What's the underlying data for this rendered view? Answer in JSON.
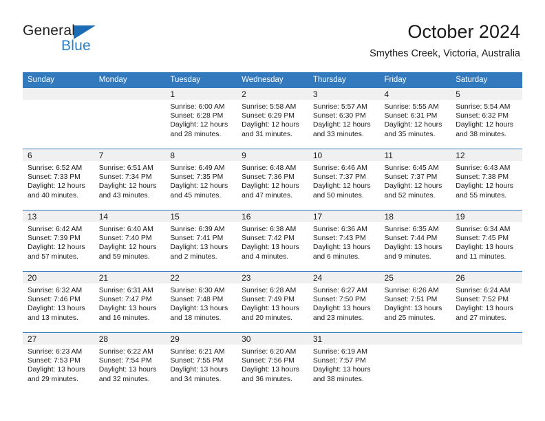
{
  "brand": {
    "name_top": "General",
    "name_bottom": "Blue",
    "color_dark": "#231f20",
    "color_blue": "#2a7fc9",
    "triangle_color": "#1b6cb5"
  },
  "header": {
    "title": "October 2024",
    "subtitle": "Smythes Creek, Victoria, Australia"
  },
  "theme": {
    "header_bar": "#3379bd",
    "daynum_band": "#f0f0f0",
    "grid_line": "#3379bd",
    "text": "#1a1a1a"
  },
  "labels": {
    "sunrise_prefix": "Sunrise:",
    "sunset_prefix": "Sunset:",
    "daylight_prefix": "Daylight:"
  },
  "weekdays": [
    "Sunday",
    "Monday",
    "Tuesday",
    "Wednesday",
    "Thursday",
    "Friday",
    "Saturday"
  ],
  "weeks": [
    [
      {
        "day": "",
        "empty": true,
        "sunrise": "",
        "sunset": "",
        "daylight_line1": "",
        "daylight_line2": ""
      },
      {
        "day": "",
        "empty": true,
        "sunrise": "",
        "sunset": "",
        "daylight_line1": "",
        "daylight_line2": ""
      },
      {
        "day": "1",
        "sunrise": "Sunrise: 6:00 AM",
        "sunset": "Sunset: 6:28 PM",
        "daylight_line1": "Daylight: 12 hours",
        "daylight_line2": "and 28 minutes."
      },
      {
        "day": "2",
        "sunrise": "Sunrise: 5:58 AM",
        "sunset": "Sunset: 6:29 PM",
        "daylight_line1": "Daylight: 12 hours",
        "daylight_line2": "and 31 minutes."
      },
      {
        "day": "3",
        "sunrise": "Sunrise: 5:57 AM",
        "sunset": "Sunset: 6:30 PM",
        "daylight_line1": "Daylight: 12 hours",
        "daylight_line2": "and 33 minutes."
      },
      {
        "day": "4",
        "sunrise": "Sunrise: 5:55 AM",
        "sunset": "Sunset: 6:31 PM",
        "daylight_line1": "Daylight: 12 hours",
        "daylight_line2": "and 35 minutes."
      },
      {
        "day": "5",
        "sunrise": "Sunrise: 5:54 AM",
        "sunset": "Sunset: 6:32 PM",
        "daylight_line1": "Daylight: 12 hours",
        "daylight_line2": "and 38 minutes."
      }
    ],
    [
      {
        "day": "6",
        "sunrise": "Sunrise: 6:52 AM",
        "sunset": "Sunset: 7:33 PM",
        "daylight_line1": "Daylight: 12 hours",
        "daylight_line2": "and 40 minutes."
      },
      {
        "day": "7",
        "sunrise": "Sunrise: 6:51 AM",
        "sunset": "Sunset: 7:34 PM",
        "daylight_line1": "Daylight: 12 hours",
        "daylight_line2": "and 43 minutes."
      },
      {
        "day": "8",
        "sunrise": "Sunrise: 6:49 AM",
        "sunset": "Sunset: 7:35 PM",
        "daylight_line1": "Daylight: 12 hours",
        "daylight_line2": "and 45 minutes."
      },
      {
        "day": "9",
        "sunrise": "Sunrise: 6:48 AM",
        "sunset": "Sunset: 7:36 PM",
        "daylight_line1": "Daylight: 12 hours",
        "daylight_line2": "and 47 minutes."
      },
      {
        "day": "10",
        "sunrise": "Sunrise: 6:46 AM",
        "sunset": "Sunset: 7:37 PM",
        "daylight_line1": "Daylight: 12 hours",
        "daylight_line2": "and 50 minutes."
      },
      {
        "day": "11",
        "sunrise": "Sunrise: 6:45 AM",
        "sunset": "Sunset: 7:37 PM",
        "daylight_line1": "Daylight: 12 hours",
        "daylight_line2": "and 52 minutes."
      },
      {
        "day": "12",
        "sunrise": "Sunrise: 6:43 AM",
        "sunset": "Sunset: 7:38 PM",
        "daylight_line1": "Daylight: 12 hours",
        "daylight_line2": "and 55 minutes."
      }
    ],
    [
      {
        "day": "13",
        "sunrise": "Sunrise: 6:42 AM",
        "sunset": "Sunset: 7:39 PM",
        "daylight_line1": "Daylight: 12 hours",
        "daylight_line2": "and 57 minutes."
      },
      {
        "day": "14",
        "sunrise": "Sunrise: 6:40 AM",
        "sunset": "Sunset: 7:40 PM",
        "daylight_line1": "Daylight: 12 hours",
        "daylight_line2": "and 59 minutes."
      },
      {
        "day": "15",
        "sunrise": "Sunrise: 6:39 AM",
        "sunset": "Sunset: 7:41 PM",
        "daylight_line1": "Daylight: 13 hours",
        "daylight_line2": "and 2 minutes."
      },
      {
        "day": "16",
        "sunrise": "Sunrise: 6:38 AM",
        "sunset": "Sunset: 7:42 PM",
        "daylight_line1": "Daylight: 13 hours",
        "daylight_line2": "and 4 minutes."
      },
      {
        "day": "17",
        "sunrise": "Sunrise: 6:36 AM",
        "sunset": "Sunset: 7:43 PM",
        "daylight_line1": "Daylight: 13 hours",
        "daylight_line2": "and 6 minutes."
      },
      {
        "day": "18",
        "sunrise": "Sunrise: 6:35 AM",
        "sunset": "Sunset: 7:44 PM",
        "daylight_line1": "Daylight: 13 hours",
        "daylight_line2": "and 9 minutes."
      },
      {
        "day": "19",
        "sunrise": "Sunrise: 6:34 AM",
        "sunset": "Sunset: 7:45 PM",
        "daylight_line1": "Daylight: 13 hours",
        "daylight_line2": "and 11 minutes."
      }
    ],
    [
      {
        "day": "20",
        "sunrise": "Sunrise: 6:32 AM",
        "sunset": "Sunset: 7:46 PM",
        "daylight_line1": "Daylight: 13 hours",
        "daylight_line2": "and 13 minutes."
      },
      {
        "day": "21",
        "sunrise": "Sunrise: 6:31 AM",
        "sunset": "Sunset: 7:47 PM",
        "daylight_line1": "Daylight: 13 hours",
        "daylight_line2": "and 16 minutes."
      },
      {
        "day": "22",
        "sunrise": "Sunrise: 6:30 AM",
        "sunset": "Sunset: 7:48 PM",
        "daylight_line1": "Daylight: 13 hours",
        "daylight_line2": "and 18 minutes."
      },
      {
        "day": "23",
        "sunrise": "Sunrise: 6:28 AM",
        "sunset": "Sunset: 7:49 PM",
        "daylight_line1": "Daylight: 13 hours",
        "daylight_line2": "and 20 minutes."
      },
      {
        "day": "24",
        "sunrise": "Sunrise: 6:27 AM",
        "sunset": "Sunset: 7:50 PM",
        "daylight_line1": "Daylight: 13 hours",
        "daylight_line2": "and 23 minutes."
      },
      {
        "day": "25",
        "sunrise": "Sunrise: 6:26 AM",
        "sunset": "Sunset: 7:51 PM",
        "daylight_line1": "Daylight: 13 hours",
        "daylight_line2": "and 25 minutes."
      },
      {
        "day": "26",
        "sunrise": "Sunrise: 6:24 AM",
        "sunset": "Sunset: 7:52 PM",
        "daylight_line1": "Daylight: 13 hours",
        "daylight_line2": "and 27 minutes."
      }
    ],
    [
      {
        "day": "27",
        "sunrise": "Sunrise: 6:23 AM",
        "sunset": "Sunset: 7:53 PM",
        "daylight_line1": "Daylight: 13 hours",
        "daylight_line2": "and 29 minutes."
      },
      {
        "day": "28",
        "sunrise": "Sunrise: 6:22 AM",
        "sunset": "Sunset: 7:54 PM",
        "daylight_line1": "Daylight: 13 hours",
        "daylight_line2": "and 32 minutes."
      },
      {
        "day": "29",
        "sunrise": "Sunrise: 6:21 AM",
        "sunset": "Sunset: 7:55 PM",
        "daylight_line1": "Daylight: 13 hours",
        "daylight_line2": "and 34 minutes."
      },
      {
        "day": "30",
        "sunrise": "Sunrise: 6:20 AM",
        "sunset": "Sunset: 7:56 PM",
        "daylight_line1": "Daylight: 13 hours",
        "daylight_line2": "and 36 minutes."
      },
      {
        "day": "31",
        "sunrise": "Sunrise: 6:19 AM",
        "sunset": "Sunset: 7:57 PM",
        "daylight_line1": "Daylight: 13 hours",
        "daylight_line2": "and 38 minutes."
      },
      {
        "day": "",
        "empty": true,
        "sunrise": "",
        "sunset": "",
        "daylight_line1": "",
        "daylight_line2": ""
      },
      {
        "day": "",
        "empty": true,
        "sunrise": "",
        "sunset": "",
        "daylight_line1": "",
        "daylight_line2": ""
      }
    ]
  ]
}
